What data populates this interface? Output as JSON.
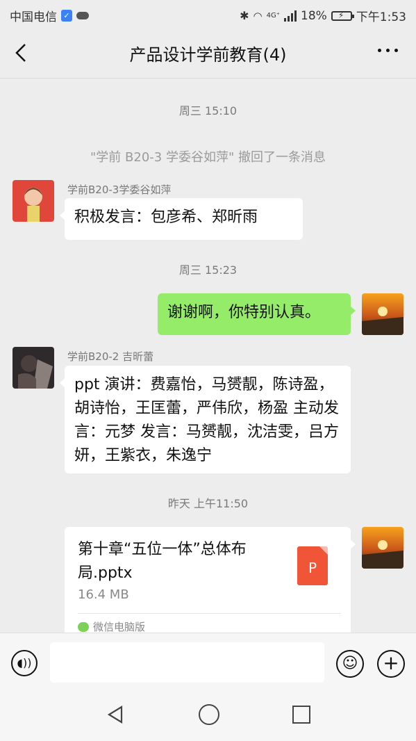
{
  "status_bar": {
    "carrier": "中国电信",
    "network": "4G⁺",
    "battery": "18%",
    "time": "下午1:53"
  },
  "header": {
    "title": "产品设计学前教育(4)"
  },
  "chat": {
    "time_1": "周三 15:10",
    "recall_notice": "\"学前 B20-3 学委谷如萍\" 撤回了一条消息",
    "msg1": {
      "sender": "学前B20-3学委谷如萍",
      "text": "积极发言：包彦希、郑昕雨"
    },
    "time_2": "周三 15:23",
    "msg2": {
      "text": "谢谢啊，你特别认真。"
    },
    "msg3": {
      "sender": "学前B20-2 吉昕蕾",
      "text": "ppt 演讲：费嘉怡，马赟靓，陈诗盈，胡诗怡，王匡蕾，严伟欣，杨盈 主动发言：元梦 发言：马赟靓，沈洁雯，吕方妍，王紫衣，朱逸宁"
    },
    "time_3": "昨天 上午11:50",
    "file": {
      "name": "第十章“五位一体”总体布局.pptx",
      "size": "16.4 MB",
      "type_letter": "P",
      "source": "微信电脑版"
    }
  },
  "input_bar": {
    "placeholder": ""
  },
  "colors": {
    "background": "#ededed",
    "own_bubble": "#95ec69",
    "file_icon": "#f05537"
  }
}
